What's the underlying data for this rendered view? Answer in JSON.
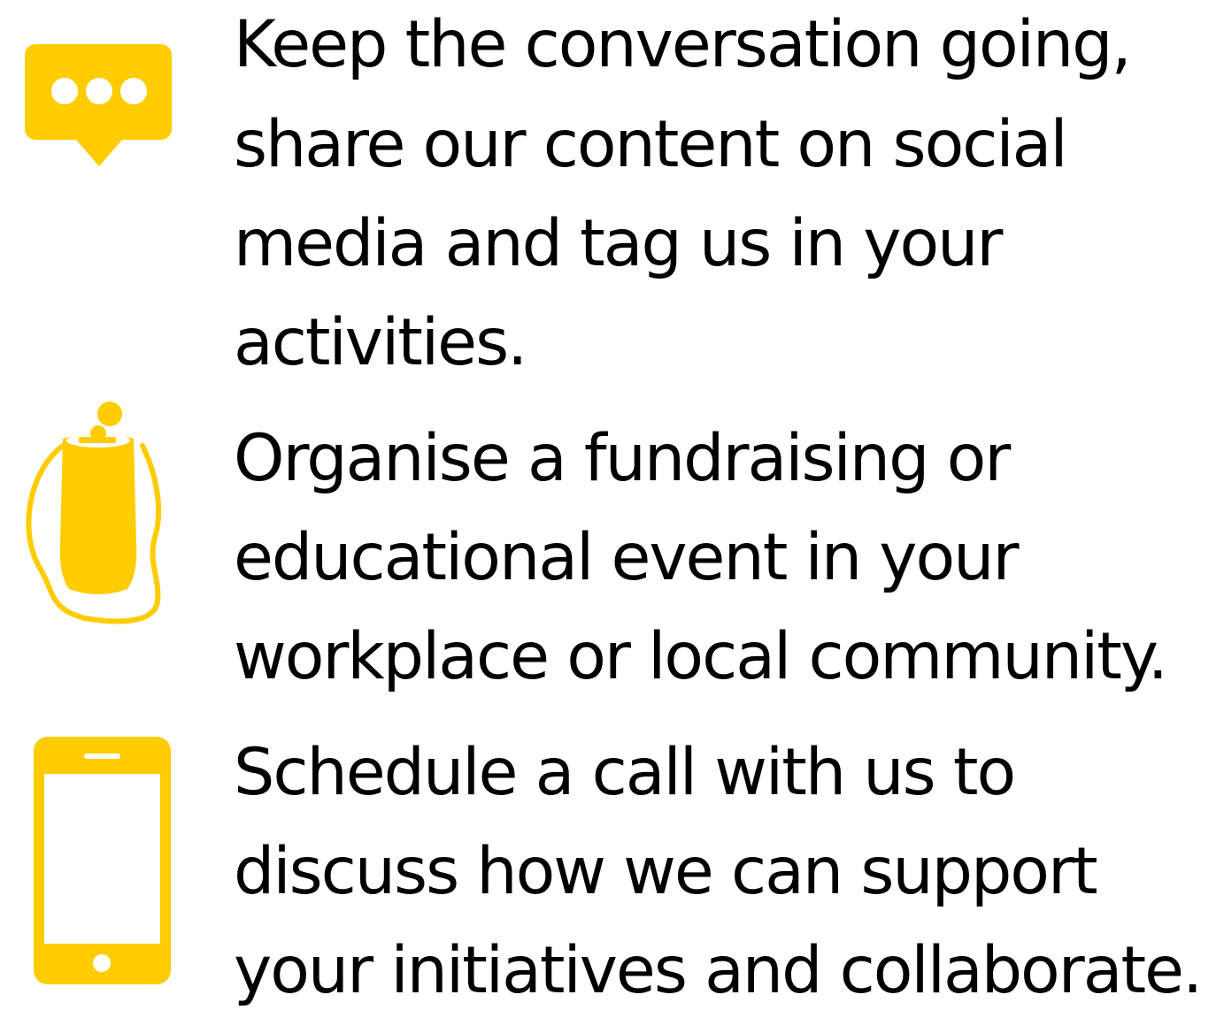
{
  "colors": {
    "accent": "#FFCC00",
    "text": "#000000",
    "background": "#FFFFFF"
  },
  "items": [
    {
      "icon": "speech-bubble-icon",
      "lines": [
        "Keep the conversation going,",
        "share our content on social",
        "media and tag us in your",
        "activities."
      ]
    },
    {
      "icon": "donation-tin-icon",
      "lines": [
        "Organise a fundraising or",
        "educational event in your",
        "workplace or local community."
      ]
    },
    {
      "icon": "mobile-phone-icon",
      "lines": [
        "Schedule a call with us to",
        "discuss how we can support",
        "your initiatives and collaborate."
      ]
    }
  ]
}
